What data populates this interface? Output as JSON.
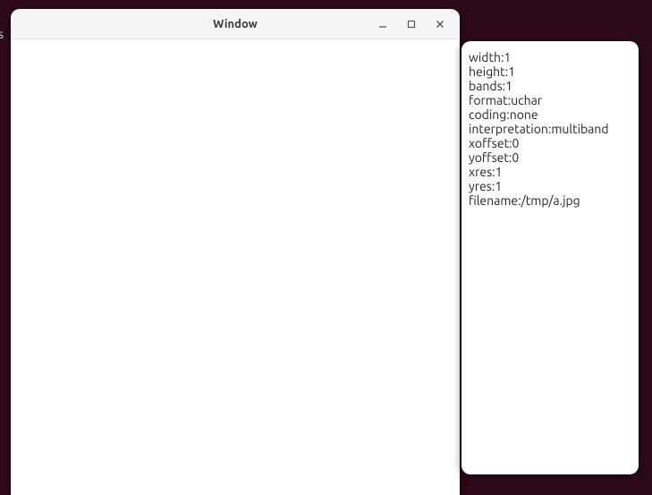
{
  "edge": {
    "text": "s"
  },
  "window": {
    "title": "Window"
  },
  "properties": [
    {
      "key": "width",
      "value": "1"
    },
    {
      "key": "height",
      "value": "1"
    },
    {
      "key": "bands",
      "value": "1"
    },
    {
      "key": "format",
      "value": "uchar"
    },
    {
      "key": "coding",
      "value": "none"
    },
    {
      "key": "interpretation",
      "value": "multiband"
    },
    {
      "key": "xoffset",
      "value": "0"
    },
    {
      "key": "yoffset",
      "value": "0"
    },
    {
      "key": "xres",
      "value": "1"
    },
    {
      "key": "yres",
      "value": "1"
    },
    {
      "key": "filename",
      "value": "/tmp/a.jpg"
    }
  ]
}
